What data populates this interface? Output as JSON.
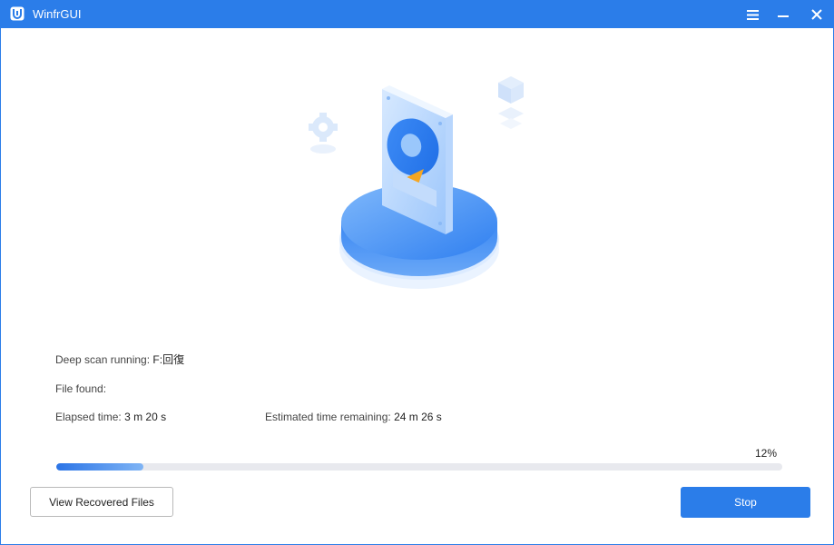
{
  "window": {
    "title": "WinfrGUI",
    "accent_color": "#2b7de9"
  },
  "titlebar": {
    "icons": [
      "app-logo-icon",
      "menu-icon",
      "minimize-icon",
      "close-icon"
    ]
  },
  "illustration": {
    "icon": "hard-drive-scan-icon"
  },
  "scan": {
    "status_label": "Deep scan running",
    "status_sep": ":",
    "status_value": "F:回復",
    "found_label": "File found",
    "found_sep": ":",
    "found_value": "",
    "elapsed_label": "Elapsed time",
    "elapsed_sep": ":",
    "elapsed_value": "3 m 20 s",
    "remaining_label": "Estimated time remaining",
    "remaining_sep": ":",
    "remaining_value": "24 m 26 s",
    "progress_percent": 12,
    "progress_text": "12%"
  },
  "actions": {
    "view_label": "View Recovered Files",
    "stop_label": "Stop"
  }
}
